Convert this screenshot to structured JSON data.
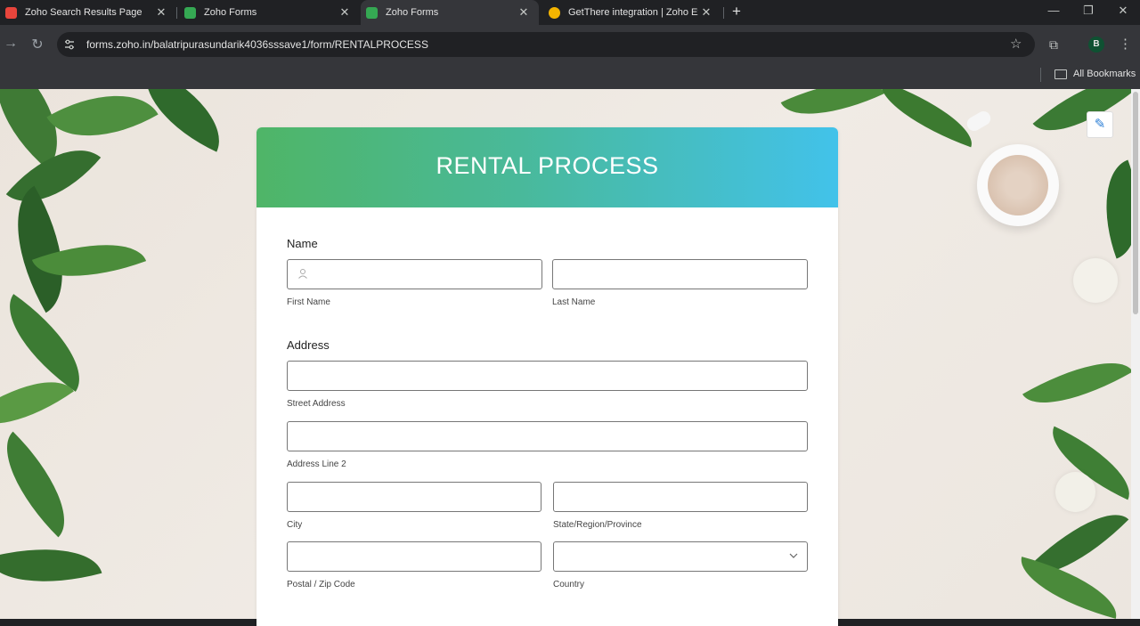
{
  "browser": {
    "tabs": [
      {
        "title": "Zoho Search Results Page",
        "active": false,
        "favicon_color": "#e8453c"
      },
      {
        "title": "Zoho Forms",
        "active": false,
        "favicon_color": "#35a853"
      },
      {
        "title": "Zoho Forms",
        "active": true,
        "favicon_color": "#35a853"
      },
      {
        "title": "GetThere integration | Zoho Exp",
        "active": false,
        "favicon_color": "#f4b400"
      }
    ],
    "new_tab": "+",
    "url": "forms.zoho.in/balatripurasundarik4036sssave1/form/RENTALPROCESS",
    "profile_initial": "B",
    "bookmarks_label": "All Bookmarks"
  },
  "form": {
    "title": "RENTAL PROCESS",
    "name_section": "Name",
    "first_name_label": "First Name",
    "last_name_label": "Last Name",
    "address_section": "Address",
    "street_label": "Street Address",
    "line2_label": "Address Line 2",
    "city_label": "City",
    "state_label": "State/Region/Province",
    "postal_label": "Postal / Zip Code",
    "country_label": "Country"
  },
  "colors": {
    "header_start": "#4fb567",
    "header_end": "#42c2ea"
  }
}
